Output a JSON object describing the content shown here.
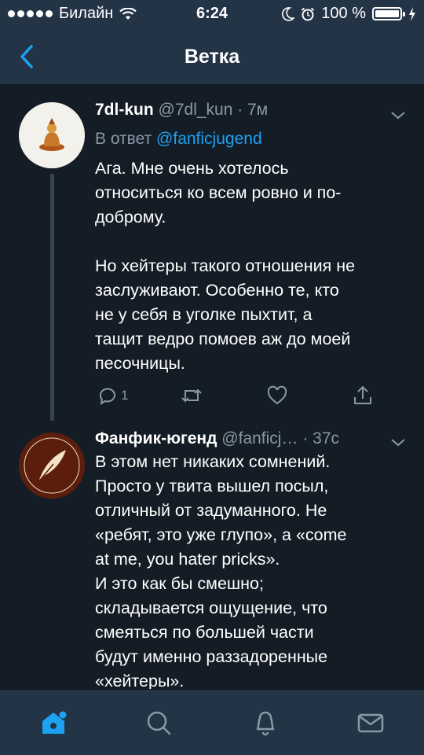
{
  "status_bar": {
    "carrier": "Билайн",
    "time": "6:24",
    "battery": "100 %"
  },
  "nav": {
    "title": "Ветка"
  },
  "tweets": [
    {
      "name": "7dl-kun",
      "handle": "@7dl_kun",
      "separator": " · ",
      "time": "7м",
      "reply_prefix": "В ответ ",
      "reply_to": "@fanficjugend",
      "text": "Ага. Мне очень хотелось\nотноситься ко всем ровно и по-\nдоброму.\n\nНо хейтеры такого отношения не\nзаслуживают. Особенно те, кто\nне у себя в уголке пыхтит, а\nтащит ведро помоев аж до моей\nпесочницы.",
      "reply_count": "1"
    },
    {
      "name": "Фанфик-югенд",
      "handle": "@fanficj…",
      "separator": " · ",
      "time": "37с",
      "text": "В этом нет никаких сомнений.\nПросто у твита вышел посыл,\nотличный от задуманного. Не\n«ребят, это уже глупо», а «come\nat me, you hater pricks».\nИ это как бы смешно;\nскладывается ощущение, что\nсмеяться по большей части\nбудут именно раззадоренные\n«хейтеры»."
    }
  ],
  "tab_bar": {
    "active": "home"
  },
  "colors": {
    "accent": "#1da1f2",
    "background": "#141d26",
    "bar": "#243447",
    "muted": "#8899a6"
  }
}
